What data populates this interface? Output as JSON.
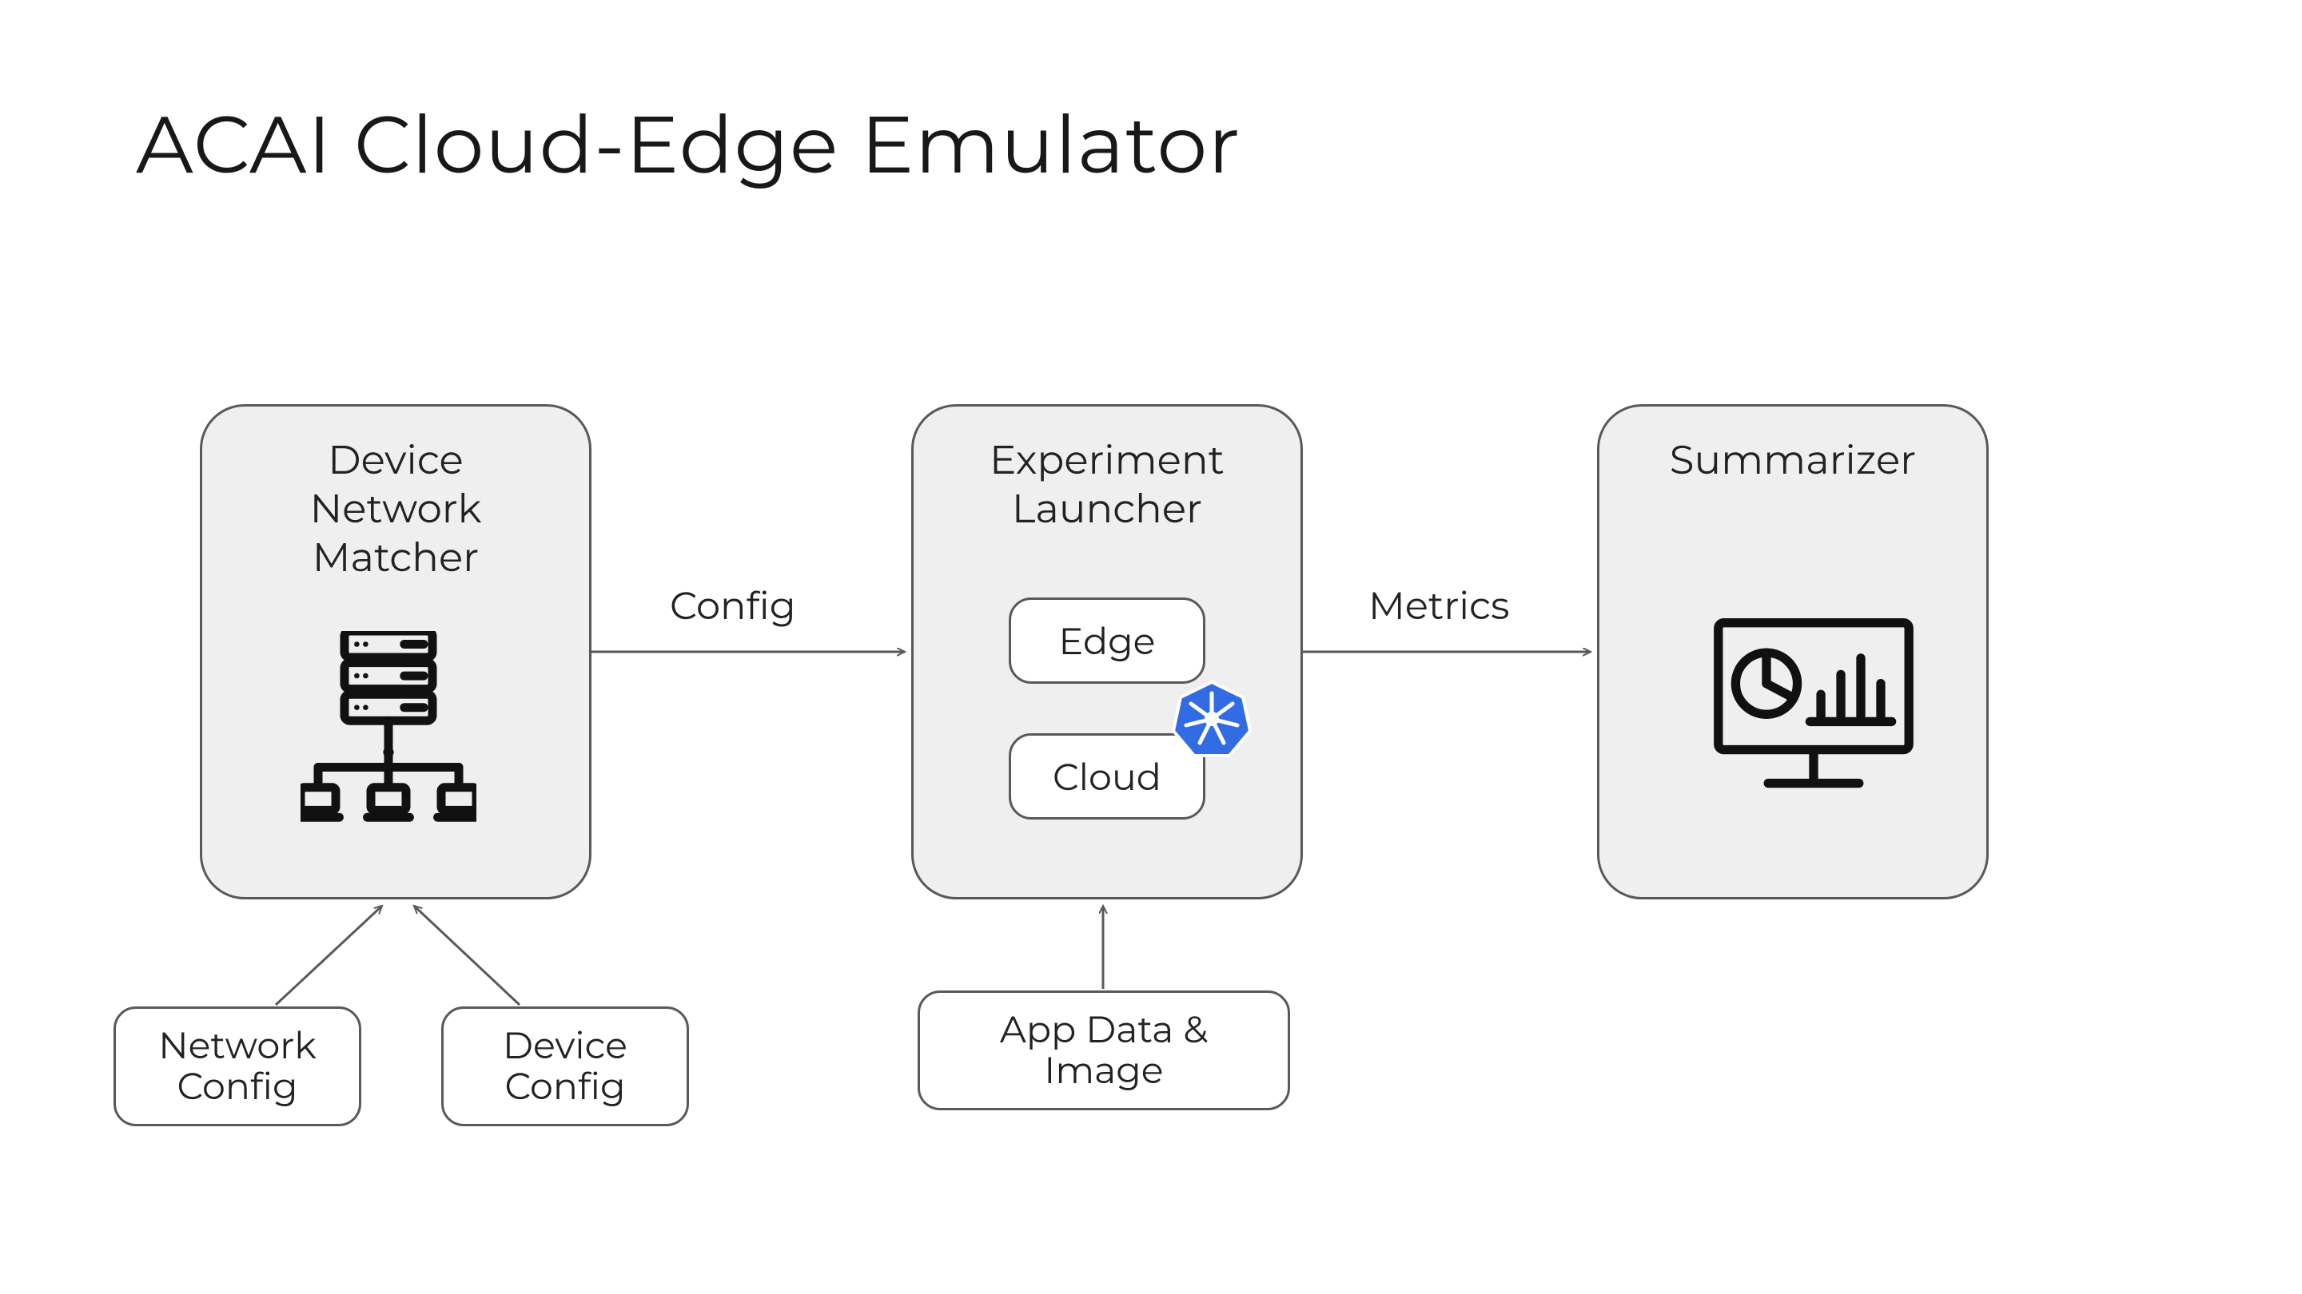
{
  "title": "ACAI Cloud-Edge Emulator",
  "boxes": {
    "device": {
      "line1": "Device",
      "line2": "Network",
      "line3": "Matcher"
    },
    "experiment": {
      "line1": "Experiment",
      "line2": "Launcher"
    },
    "summarizer": {
      "line1": "Summarizer"
    }
  },
  "sub": {
    "edge": "Edge",
    "cloud": "Cloud"
  },
  "inputs": {
    "network_config": {
      "line1": "Network",
      "line2": "Config"
    },
    "device_config": {
      "line1": "Device",
      "line2": "Config"
    },
    "app_data": {
      "line1": "App Data &",
      "line2": "Image"
    }
  },
  "arrows": {
    "config": "Config",
    "metrics": "Metrics"
  },
  "colors": {
    "box_fill": "#efefef",
    "box_border": "#595959",
    "k8s_blue": "#326ce5",
    "text": "#1a1a1a"
  }
}
